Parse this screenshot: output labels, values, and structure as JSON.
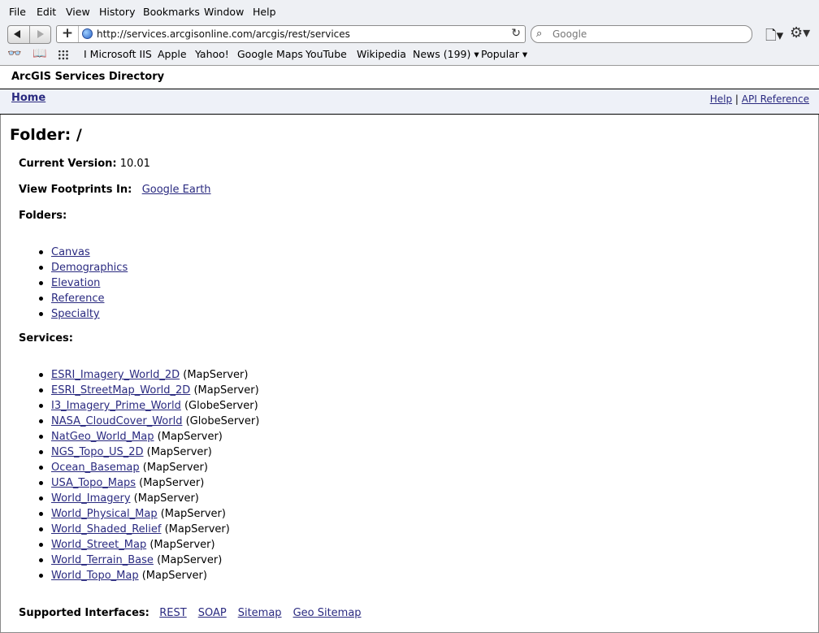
{
  "menu": [
    "File",
    "Edit",
    "View",
    "History",
    "Bookmarks",
    "Window",
    "Help"
  ],
  "toolbar": {
    "url": "http://services.arcgisonline.com/arcgis/rest/services",
    "search_placeholder": "Google"
  },
  "bookmarks": [
    "I Microsoft IIS",
    "Apple",
    "Yahoo!",
    "Google Maps",
    "YouTube",
    "Wikipedia",
    "News (199) ▾",
    "Popular ▾"
  ],
  "page": {
    "header_title": "ArcGIS Services Directory",
    "home": "Home",
    "help": "Help",
    "separator": "|",
    "api_reference": "API Reference",
    "folder_title": "Folder: /",
    "current_version_label": "Current Version:",
    "current_version": "10.01",
    "footprints_label": "View Footprints In:",
    "footprints_link": "Google Earth",
    "folders_label": "Folders:",
    "folders": [
      "Canvas",
      "Demographics",
      "Elevation",
      "Reference",
      "Specialty"
    ],
    "services_label": "Services:",
    "services": [
      {
        "name": "ESRI_Imagery_World_2D",
        "type": "(MapServer)"
      },
      {
        "name": "ESRI_StreetMap_World_2D",
        "type": "(MapServer)"
      },
      {
        "name": "I3_Imagery_Prime_World",
        "type": "(GlobeServer)"
      },
      {
        "name": "NASA_CloudCover_World",
        "type": "(GlobeServer)"
      },
      {
        "name": "NatGeo_World_Map",
        "type": "(MapServer)"
      },
      {
        "name": "NGS_Topo_US_2D",
        "type": "(MapServer)"
      },
      {
        "name": "Ocean_Basemap",
        "type": "(MapServer)"
      },
      {
        "name": "USA_Topo_Maps",
        "type": "(MapServer)"
      },
      {
        "name": "World_Imagery",
        "type": "(MapServer)"
      },
      {
        "name": "World_Physical_Map",
        "type": "(MapServer)"
      },
      {
        "name": "World_Shaded_Relief",
        "type": "(MapServer)"
      },
      {
        "name": "World_Street_Map",
        "type": "(MapServer)"
      },
      {
        "name": "World_Terrain_Base",
        "type": "(MapServer)"
      },
      {
        "name": "World_Topo_Map",
        "type": "(MapServer)"
      }
    ],
    "interfaces_label": "Supported Interfaces:",
    "interfaces": [
      "REST",
      "SOAP",
      "Sitemap",
      "Geo Sitemap"
    ]
  }
}
